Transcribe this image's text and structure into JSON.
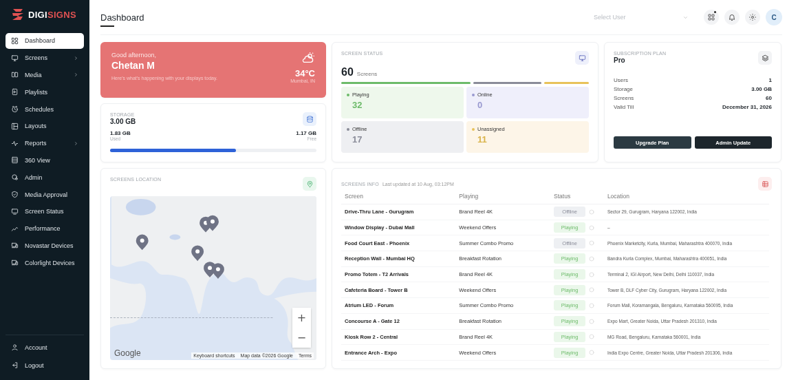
{
  "brand": {
    "prefix": "DIGI",
    "suffix": "SIGNS"
  },
  "sidebar": {
    "items": [
      {
        "label": "Dashboard",
        "selected": true,
        "expandable": false
      },
      {
        "label": "Screens",
        "selected": false,
        "expandable": true
      },
      {
        "label": "Media",
        "selected": false,
        "expandable": true
      },
      {
        "label": "Playlists",
        "selected": false,
        "expandable": false
      },
      {
        "label": "Schedules",
        "selected": false,
        "expandable": false
      },
      {
        "label": "Layouts",
        "selected": false,
        "expandable": false
      },
      {
        "label": "Reports",
        "selected": false,
        "expandable": true
      },
      {
        "label": "360 View",
        "selected": false,
        "expandable": false
      },
      {
        "label": "Admin",
        "selected": false,
        "expandable": false
      },
      {
        "label": "Media Approval",
        "selected": false,
        "expandable": false
      },
      {
        "label": "Screen Status",
        "selected": false,
        "expandable": false
      },
      {
        "label": "Performance",
        "selected": false,
        "expandable": false
      },
      {
        "label": "Novastar Devices",
        "selected": false,
        "expandable": false
      },
      {
        "label": "Colorlight Devices",
        "selected": false,
        "expandable": false
      }
    ],
    "footer": [
      {
        "label": "Account"
      },
      {
        "label": "Logout"
      }
    ]
  },
  "header": {
    "title": "Dashboard",
    "user_select": {
      "placeholder": "Select User"
    },
    "avatar": "C"
  },
  "welcome": {
    "greeting": "Good afternoon,",
    "name": "Chetan M",
    "subtitle": "Here's what's happening with your displays today.",
    "temperature": "34°C",
    "place": "Mumbai, IN"
  },
  "storage": {
    "title": "STORAGE",
    "total": "3.00 GB",
    "used": "1.83 GB",
    "used_label": "Used",
    "free": "1.17 GB",
    "free_label": "Free",
    "level": 0.61
  },
  "screen_status": {
    "title": "SCREEN STATUS",
    "count": "60",
    "count_label": "Screens",
    "tiles": [
      {
        "kind": "playing",
        "label": "Playing",
        "value": "32",
        "color": "#6dbb6a"
      },
      {
        "kind": "online",
        "label": "Online",
        "value": "0",
        "color": "#9a9ad0"
      },
      {
        "kind": "offline",
        "label": "Offline",
        "value": "17",
        "color": "#8a8c99"
      },
      {
        "kind": "unassigned",
        "label": "Unassigned",
        "value": "11",
        "color": "#e8c25a"
      }
    ]
  },
  "subscription": {
    "title": "SUBSCRIPTION PLAN",
    "plan": "Pro",
    "rows": [
      {
        "label": "Users",
        "value": "1"
      },
      {
        "label": "Storage",
        "value": "3.00 GB"
      },
      {
        "label": "Screens",
        "value": "60"
      },
      {
        "label": "Valid Till",
        "value": "December 31, 2026"
      }
    ],
    "buttons": [
      {
        "kind": "upgrade",
        "label": "Upgrade Plan"
      },
      {
        "kind": "admin",
        "label": "Admin Update"
      }
    ]
  },
  "map": {
    "title": "SCREENS LOCATION",
    "logo": "Google",
    "attribution": [
      "Keyboard shortcuts",
      "Map data ©2026 Google",
      "Terms"
    ],
    "zoom": [
      "+",
      "−"
    ]
  },
  "screens_info": {
    "title": "SCREENS INFO",
    "updated": "Last updated at 10 Aug, 03:12PM",
    "columns": [
      "Screen",
      "Playing",
      "Status",
      "Location"
    ],
    "rows": [
      {
        "screen": "Drive-Thru Lane - Gurugram",
        "playing": "Brand Reel 4K",
        "status": "Offline",
        "kind": "offline",
        "location": "Sector 29, Gurugram, Haryana 122002, India"
      },
      {
        "screen": "Window Display - Dubai Mall",
        "playing": "Weekend Offers",
        "status": "Playing",
        "kind": "playing",
        "location": "–"
      },
      {
        "screen": "Food Court East - Phoenix",
        "playing": "Summer Combo Promo",
        "status": "Offline",
        "kind": "offline",
        "location": "Phoenix Marketcity, Kurla, Mumbai, Maharashtra 400070, India"
      },
      {
        "screen": "Reception Wall - Mumbai HQ",
        "playing": "Breakfast Rotation",
        "status": "Playing",
        "kind": "playing",
        "location": "Bandra Kurla Complex, Mumbai, Maharashtra 400051, India"
      },
      {
        "screen": "Promo Totem - T2 Arrivals",
        "playing": "Brand Reel 4K",
        "status": "Playing",
        "kind": "playing",
        "location": "Terminal 2, IGI Airport, New Delhi, Delhi 110037, India"
      },
      {
        "screen": "Cafeteria Board - Tower B",
        "playing": "Weekend Offers",
        "status": "Playing",
        "kind": "playing",
        "location": "Tower B, DLF Cyber City, Gurugram, Haryana 122002, India"
      },
      {
        "screen": "Atrium LED - Forum",
        "playing": "Summer Combo Promo",
        "status": "Playing",
        "kind": "playing",
        "location": "Forum Mall, Koramangala, Bengaluru, Karnataka 560095, India"
      },
      {
        "screen": "Concourse A - Gate 12",
        "playing": "Breakfast Rotation",
        "status": "Playing",
        "kind": "playing",
        "location": "Expo Mart, Greater Noida, Uttar Pradesh 201310, India"
      },
      {
        "screen": "Kiosk Row 2 - Central",
        "playing": "Brand Reel 4K",
        "status": "Playing",
        "kind": "playing",
        "location": "MG Road, Bengaluru, Karnataka 560001, India"
      },
      {
        "screen": "Entrance Arch - Expo",
        "playing": "Weekend Offers",
        "status": "Playing",
        "kind": "playing",
        "location": "India Expo Centre, Greater Noida, Uttar Pradesh 201306, India"
      }
    ]
  }
}
